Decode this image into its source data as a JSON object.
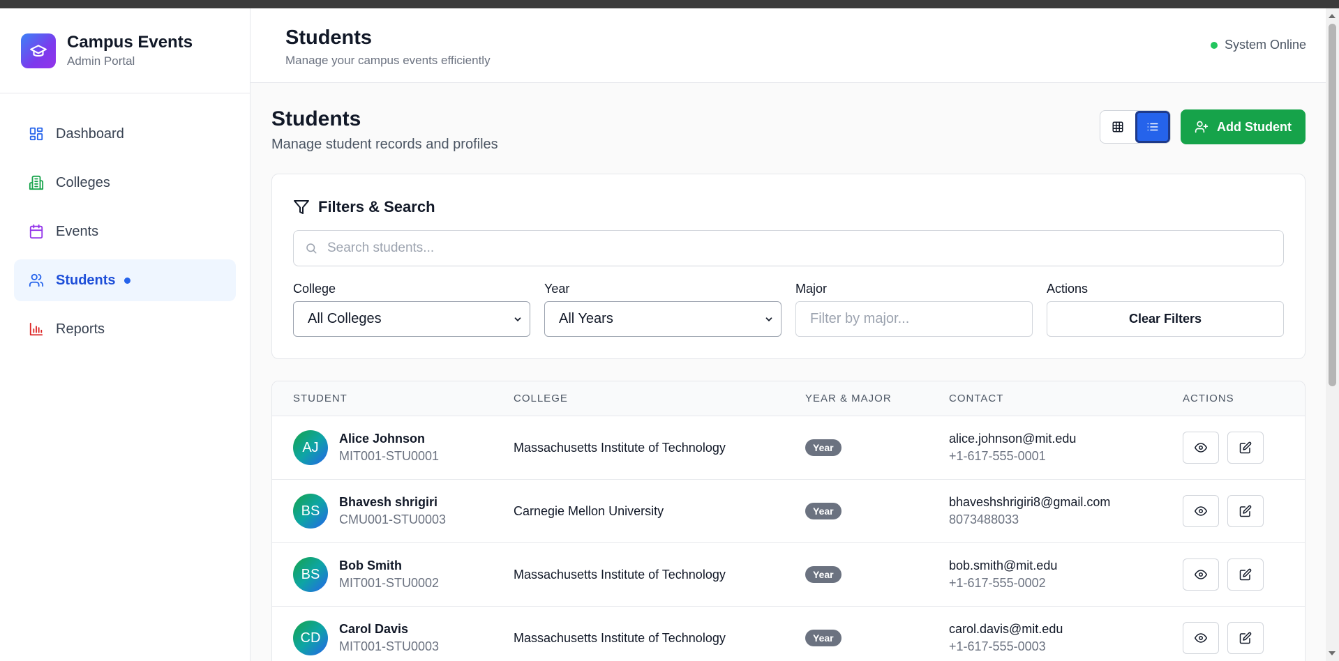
{
  "brand": {
    "title": "Campus Events",
    "subtitle": "Admin Portal",
    "icon": "graduation-cap-icon",
    "gradient": [
      "#3b82f6",
      "#9333ea"
    ]
  },
  "sidebar": {
    "items": [
      {
        "label": "Dashboard",
        "icon": "layout-dashboard-icon",
        "color": "#2563eb",
        "active": false
      },
      {
        "label": "Colleges",
        "icon": "building-icon",
        "color": "#16a34a",
        "active": false
      },
      {
        "label": "Events",
        "icon": "calendar-icon",
        "color": "#9333ea",
        "active": false
      },
      {
        "label": "Students",
        "icon": "users-icon",
        "color": "#2563eb",
        "active": true
      },
      {
        "label": "Reports",
        "icon": "bar-chart-icon",
        "color": "#dc2626",
        "active": false
      }
    ]
  },
  "header": {
    "title": "Students",
    "subtitle": "Manage your campus events efficiently",
    "status": "System Online",
    "status_color": "#22c55e"
  },
  "page": {
    "title": "Students",
    "subtitle": "Manage student records and profiles",
    "add_button": "Add Student",
    "add_button_color": "#16a34a",
    "view_modes": [
      "grid",
      "list"
    ],
    "active_view": "list"
  },
  "filters": {
    "title": "Filters & Search",
    "search_placeholder": "Search students...",
    "college_label": "College",
    "college_value": "All Colleges",
    "year_label": "Year",
    "year_value": "All Years",
    "major_label": "Major",
    "major_placeholder": "Filter by major...",
    "actions_label": "Actions",
    "clear_button": "Clear Filters"
  },
  "table": {
    "columns": [
      "STUDENT",
      "COLLEGE",
      "YEAR & MAJOR",
      "CONTACT",
      "ACTIONS"
    ],
    "rows": [
      {
        "initials": "AJ",
        "name": "Alice Johnson",
        "id": "MIT001-STU0001",
        "college": "Massachusetts Institute of Technology",
        "year": "Year",
        "email": "alice.johnson@mit.edu",
        "phone": "+1-617-555-0001"
      },
      {
        "initials": "BS",
        "name": "Bhavesh shrigiri",
        "id": "CMU001-STU0003",
        "college": "Carnegie Mellon University",
        "year": "Year",
        "email": "bhaveshshrigiri8@gmail.com",
        "phone": "8073488033"
      },
      {
        "initials": "BS",
        "name": "Bob Smith",
        "id": "MIT001-STU0002",
        "college": "Massachusetts Institute of Technology",
        "year": "Year",
        "email": "bob.smith@mit.edu",
        "phone": "+1-617-555-0002"
      },
      {
        "initials": "CD",
        "name": "Carol Davis",
        "id": "MIT001-STU0003",
        "college": "Massachusetts Institute of Technology",
        "year": "Year",
        "email": "carol.davis@mit.edu",
        "phone": "+1-617-555-0003"
      }
    ]
  }
}
